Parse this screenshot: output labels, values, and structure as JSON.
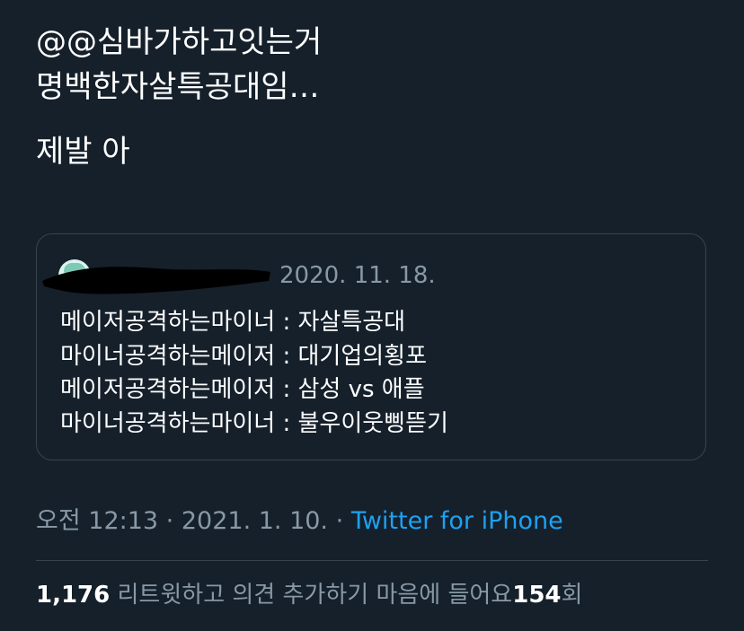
{
  "tweet": {
    "lines": [
      "@@심바가하고잇는거",
      "명백한자살특공대임…",
      "제발 아"
    ]
  },
  "quote": {
    "date": "2020. 11. 18.",
    "lines": [
      "메이저공격하는마이너 : 자살특공대",
      "마이너공격하는메이저 : 대기업의횡포",
      "메이저공격하는메이저 : 삼성 vs 애플",
      "마이너공격하는마이너 : 불우이웃삥뜯기"
    ]
  },
  "meta": {
    "time": "오전 12:13",
    "separator": "·",
    "date": "2021. 1. 10.",
    "source": "Twitter for iPhone"
  },
  "stats": {
    "retweets_count": "1,176",
    "retweets_label": "리트윗하고 의견 추가하기",
    "likes_label": "마음에 들어요",
    "likes_count": "154",
    "likes_suffix": "회"
  },
  "colors": {
    "background": "#15202b",
    "text": "#ffffff",
    "muted": "#8899a6",
    "link": "#1da1f2",
    "border": "#38444d"
  }
}
